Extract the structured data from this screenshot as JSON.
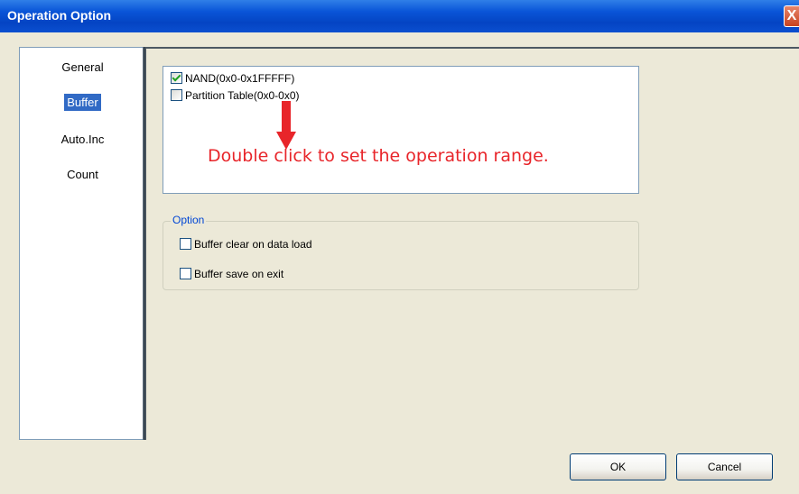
{
  "window": {
    "title": "Operation Option",
    "close_label": "X"
  },
  "nav": {
    "items": [
      {
        "label": "General",
        "selected": false
      },
      {
        "label": "Buffer",
        "selected": true
      },
      {
        "label": "Auto.Inc",
        "selected": false
      },
      {
        "label": "Count",
        "selected": false
      }
    ]
  },
  "ranges": {
    "items": [
      {
        "label": "NAND(0x0-0x1FFFFF)",
        "checked": true
      },
      {
        "label": "Partition Table(0x0-0x0)",
        "checked": false
      }
    ]
  },
  "annotation": {
    "text": "Double click to set the operation range.",
    "color": "#e8252a"
  },
  "option_group": {
    "title": "Option",
    "items": [
      {
        "label": "Buffer clear on data load",
        "checked": false
      },
      {
        "label": "Buffer save on exit",
        "checked": false
      }
    ]
  },
  "buttons": {
    "ok_label": "OK",
    "cancel_label": "Cancel"
  },
  "colors": {
    "titlebar": "#0a55d8",
    "selection": "#316ac5",
    "group_title": "#0046d5"
  }
}
